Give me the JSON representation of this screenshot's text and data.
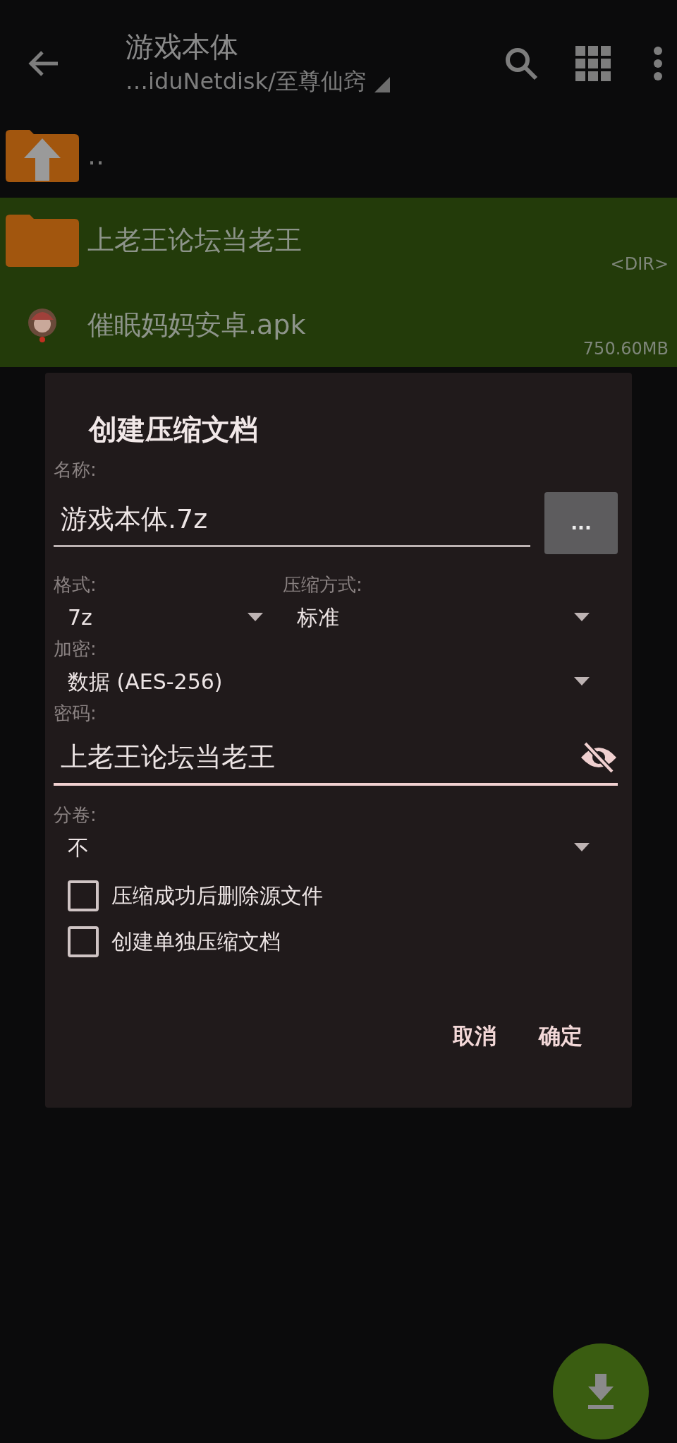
{
  "toolbar": {
    "title": "游戏本体",
    "path": "…iduNetdisk/至尊仙窍"
  },
  "files": [
    {
      "kind": "up",
      "name": "..",
      "selected": false
    },
    {
      "kind": "folder",
      "name": "上老王论坛当老王",
      "info": "<DIR>",
      "selected": true
    },
    {
      "kind": "apk",
      "name": "催眠妈妈安卓.apk",
      "info": "750.60MB",
      "selected": true
    }
  ],
  "dialog": {
    "title": "创建压缩文档",
    "name_label": "名称:",
    "name_value": "游戏本体.7z",
    "browse_button": "...",
    "format_label": "格式:",
    "format_value": "7z",
    "method_label": "压缩方式:",
    "method_value": "标准",
    "encryption_label": "加密:",
    "encryption_value": "数据 (AES-256)",
    "password_label": "密码:",
    "password_value": "上老王论坛当老王",
    "split_label": "分卷:",
    "split_value": "不",
    "options": [
      {
        "label": "压缩成功后删除源文件",
        "checked": false
      },
      {
        "label": "创建单独压缩文档",
        "checked": false
      }
    ],
    "buttons": [
      "取消",
      "确定"
    ]
  }
}
